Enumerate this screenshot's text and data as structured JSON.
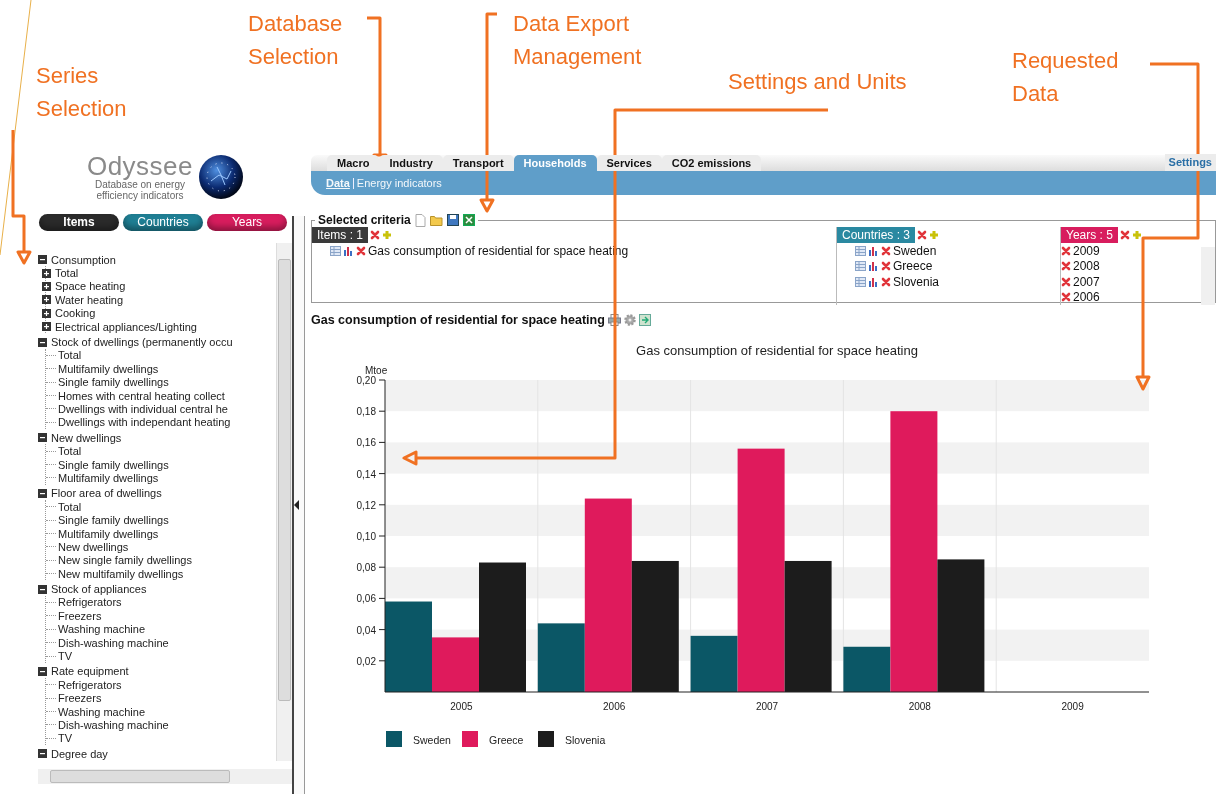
{
  "annotations": [
    {
      "text": "Series Selection"
    },
    {
      "text": "Database Selection"
    },
    {
      "text": "Data Export Management"
    },
    {
      "text": "Settings and Units"
    },
    {
      "text": "Requested Data"
    }
  ],
  "logo": {
    "name": "Odyssee",
    "tagline": "Database on energy efficiency indicators"
  },
  "panel_tabs": [
    {
      "label": "Items",
      "selected": true,
      "color": "#2b2b2b"
    },
    {
      "label": "Countries",
      "selected": false,
      "color": "#1f7f94"
    },
    {
      "label": "Years",
      "selected": false,
      "color": "#d81d5e"
    }
  ],
  "tree": [
    {
      "label": "Consumption",
      "kind": "node",
      "expanded": true,
      "children": [
        {
          "label": "Total",
          "kind": "node",
          "expanded": false
        },
        {
          "label": "Space heating",
          "kind": "node",
          "expanded": false
        },
        {
          "label": "Water heating",
          "kind": "node",
          "expanded": false
        },
        {
          "label": "Cooking",
          "kind": "node",
          "expanded": false
        },
        {
          "label": "Electrical appliances/Lighting",
          "kind": "node",
          "expanded": false
        }
      ]
    },
    {
      "label": "Stock of dwellings (permanently occu",
      "kind": "node",
      "expanded": true,
      "children": [
        {
          "label": "Total",
          "kind": "leaf"
        },
        {
          "label": "Multifamily dwellings",
          "kind": "leaf"
        },
        {
          "label": "Single family dwellings",
          "kind": "leaf"
        },
        {
          "label": "Homes with central heating collect",
          "kind": "leaf"
        },
        {
          "label": "Dwellings with individual central he",
          "kind": "leaf"
        },
        {
          "label": "Dwellings with independant heating",
          "kind": "leaf"
        }
      ]
    },
    {
      "label": "New dwellings",
      "kind": "node",
      "expanded": true,
      "children": [
        {
          "label": "Total",
          "kind": "leaf"
        },
        {
          "label": "Single family dwellings",
          "kind": "leaf"
        },
        {
          "label": "Multifamily dwellings",
          "kind": "leaf"
        }
      ]
    },
    {
      "label": "Floor area of dwellings",
      "kind": "node",
      "expanded": true,
      "children": [
        {
          "label": "Total",
          "kind": "leaf"
        },
        {
          "label": "Single family dwellings",
          "kind": "leaf"
        },
        {
          "label": "Multifamily dwellings",
          "kind": "leaf"
        },
        {
          "label": "New dwellings",
          "kind": "leaf"
        },
        {
          "label": "New single family dwellings",
          "kind": "leaf"
        },
        {
          "label": "New multifamily dwellings",
          "kind": "leaf"
        }
      ]
    },
    {
      "label": "Stock of appliances",
      "kind": "node",
      "expanded": true,
      "children": [
        {
          "label": "Refrigerators",
          "kind": "leaf"
        },
        {
          "label": "Freezers",
          "kind": "leaf"
        },
        {
          "label": "Washing machine",
          "kind": "leaf"
        },
        {
          "label": "Dish-washing machine",
          "kind": "leaf"
        },
        {
          "label": "TV",
          "kind": "leaf"
        }
      ]
    },
    {
      "label": "Rate equipment",
      "kind": "node",
      "expanded": true,
      "children": [
        {
          "label": "Refrigerators",
          "kind": "leaf"
        },
        {
          "label": "Freezers",
          "kind": "leaf"
        },
        {
          "label": "Washing machine",
          "kind": "leaf"
        },
        {
          "label": "Dish-washing machine",
          "kind": "leaf"
        },
        {
          "label": "TV",
          "kind": "leaf"
        }
      ]
    },
    {
      "label": "Degree day",
      "kind": "node",
      "expanded": true
    }
  ],
  "main_tabs": [
    {
      "label": "Macro",
      "selected": false
    },
    {
      "label": "Industry",
      "selected": false
    },
    {
      "label": "Transport",
      "selected": false
    },
    {
      "label": "Households",
      "selected": true
    },
    {
      "label": "Services",
      "selected": false
    },
    {
      "label": "CO2 emissions",
      "selected": false
    }
  ],
  "settings_link": "Settings",
  "sub_tabs": [
    {
      "label": "Data",
      "selected": true
    },
    {
      "label": "Energy indicators",
      "selected": false
    }
  ],
  "criteria": {
    "legend": "Selected criteria",
    "items": {
      "header": "Items : 1",
      "entries": [
        "Gas consumption of residential for space heating"
      ]
    },
    "countries": {
      "header": "Countries : 3",
      "entries": [
        "Sweden",
        "Greece",
        "Slovenia"
      ]
    },
    "years": {
      "header": "Years : 5",
      "entries": [
        "2009",
        "2008",
        "2007",
        "2006"
      ]
    }
  },
  "chart_heading": "Gas consumption of residential for space heating",
  "chart_data": {
    "type": "bar",
    "title": "Gas consumption of residential for space heating",
    "ylabel": "Mtoe",
    "categories": [
      "2005",
      "2006",
      "2007",
      "2008",
      "2009"
    ],
    "series": [
      {
        "name": "Sweden",
        "color": "#0b5766",
        "values": [
          0.058,
          0.044,
          0.036,
          0.029,
          null
        ]
      },
      {
        "name": "Greece",
        "color": "#df1a5c",
        "values": [
          0.035,
          0.124,
          0.156,
          0.18,
          null
        ]
      },
      {
        "name": "Slovenia",
        "color": "#1c1c1c",
        "values": [
          0.083,
          0.084,
          0.084,
          0.085,
          null
        ]
      }
    ],
    "legend": "bottom",
    "ylim": [
      0,
      0.2
    ],
    "yticks": [
      {
        "value": 0.02,
        "label": "0,02"
      },
      {
        "value": 0.04,
        "label": "0,04"
      },
      {
        "value": 0.06,
        "label": "0,06"
      },
      {
        "value": 0.08,
        "label": "0,08"
      },
      {
        "value": 0.1,
        "label": "0,10"
      },
      {
        "value": 0.12,
        "label": "0,12"
      },
      {
        "value": 0.14,
        "label": "0,14"
      },
      {
        "value": 0.16,
        "label": "0,16"
      },
      {
        "value": 0.18,
        "label": "0,18"
      },
      {
        "value": 0.2,
        "label": "0,20"
      }
    ]
  }
}
